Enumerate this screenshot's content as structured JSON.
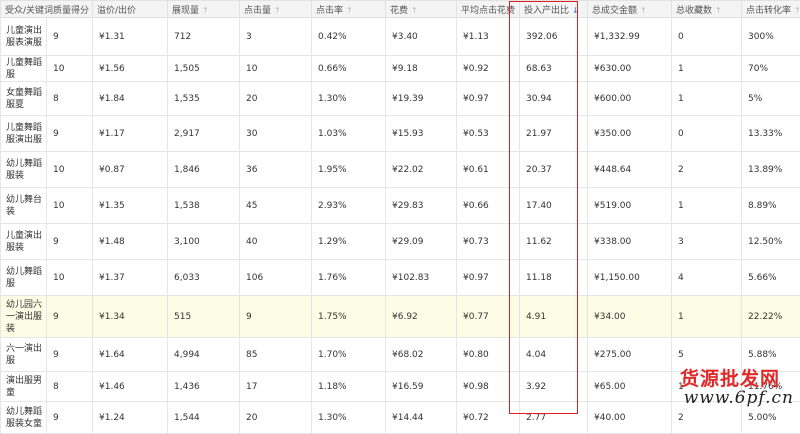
{
  "headers": [
    "受众/关键词质量得分",
    "溢价/出价",
    "展现量",
    "点击量",
    "点击率",
    "花费",
    "平均点击花费",
    "投入产出比",
    "总成交金额",
    "总收藏数",
    "点击转化率"
  ],
  "rows": [
    [
      "儿童演出服表演服",
      "9",
      "¥1.31",
      "712",
      "3",
      "0.42%",
      "¥3.40",
      "¥1.13",
      "392.06",
      "¥1,332.99",
      "0",
      "300%"
    ],
    [
      "儿童舞蹈服",
      "10",
      "¥1.56",
      "1,505",
      "10",
      "0.66%",
      "¥9.18",
      "¥0.92",
      "68.63",
      "¥630.00",
      "1",
      "70%"
    ],
    [
      "女童舞蹈服夏",
      "8",
      "¥1.84",
      "1,535",
      "20",
      "1.30%",
      "¥19.39",
      "¥0.97",
      "30.94",
      "¥600.00",
      "1",
      "5%"
    ],
    [
      "儿童舞蹈服演出服",
      "9",
      "¥1.17",
      "2,917",
      "30",
      "1.03%",
      "¥15.93",
      "¥0.53",
      "21.97",
      "¥350.00",
      "0",
      "13.33%"
    ],
    [
      "幼儿舞蹈服装",
      "10",
      "¥0.87",
      "1,846",
      "36",
      "1.95%",
      "¥22.02",
      "¥0.61",
      "20.37",
      "¥448.64",
      "2",
      "13.89%"
    ],
    [
      "幼儿舞台装",
      "10",
      "¥1.35",
      "1,538",
      "45",
      "2.93%",
      "¥29.83",
      "¥0.66",
      "17.40",
      "¥519.00",
      "1",
      "8.89%"
    ],
    [
      "儿童演出服装",
      "9",
      "¥1.48",
      "3,100",
      "40",
      "1.29%",
      "¥29.09",
      "¥0.73",
      "11.62",
      "¥338.00",
      "3",
      "12.50%"
    ],
    [
      "幼儿舞蹈服",
      "10",
      "¥1.37",
      "6,033",
      "106",
      "1.76%",
      "¥102.83",
      "¥0.97",
      "11.18",
      "¥1,150.00",
      "4",
      "5.66%"
    ],
    [
      "幼儿园六一演出服装",
      "9",
      "¥1.34",
      "515",
      "9",
      "1.75%",
      "¥6.92",
      "¥0.77",
      "4.91",
      "¥34.00",
      "1",
      "22.22%"
    ],
    [
      "六一演出服",
      "9",
      "¥1.64",
      "4,994",
      "85",
      "1.70%",
      "¥68.02",
      "¥0.80",
      "4.04",
      "¥275.00",
      "5",
      "5.88%"
    ],
    [
      "演出服男童",
      "8",
      "¥1.46",
      "1,436",
      "17",
      "1.18%",
      "¥16.59",
      "¥0.98",
      "3.92",
      "¥65.00",
      "1",
      "11.76%"
    ],
    [
      "幼儿舞蹈服装女童",
      "9",
      "¥1.24",
      "1,544",
      "20",
      "1.30%",
      "¥14.44",
      "¥0.72",
      "2.77",
      "¥40.00",
      "2",
      "5.00%"
    ]
  ],
  "highlight_row": 8,
  "sort_column": 7,
  "watermark": {
    "line1": "货源批发网",
    "line2": "www.6pf.cn"
  },
  "colors": {
    "highlight_box": "#e02020",
    "highlight_row": "#fdfde6",
    "sort_active": "#2a6dd6"
  }
}
